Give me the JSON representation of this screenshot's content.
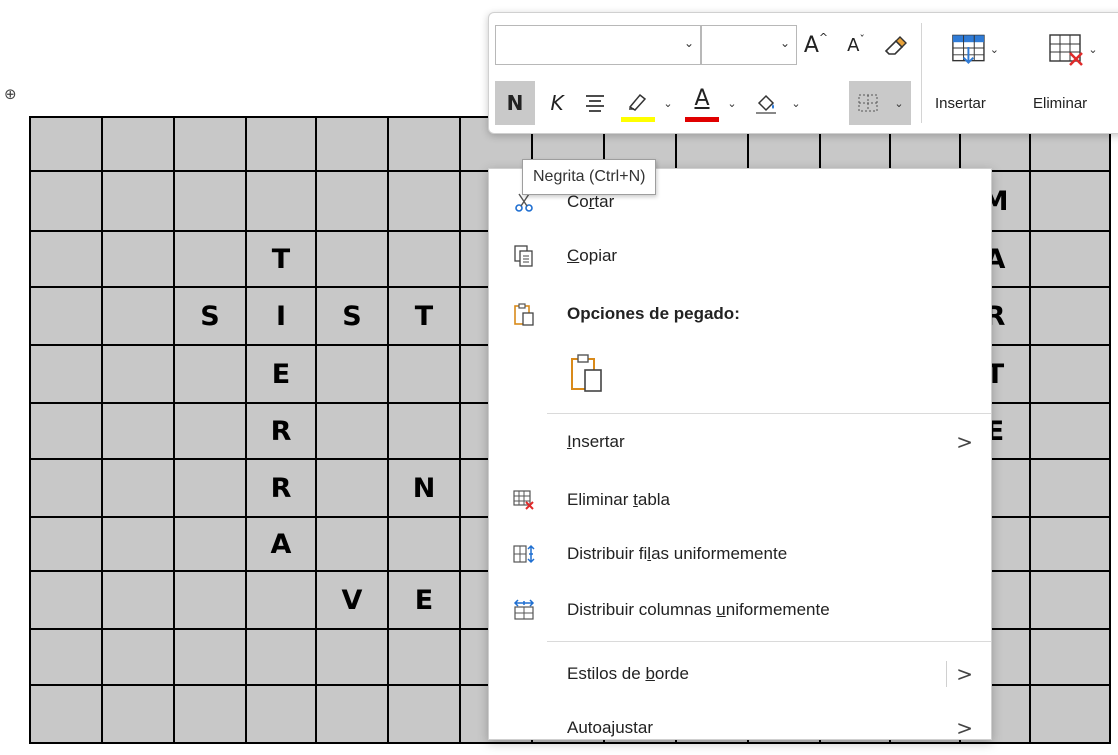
{
  "table": {
    "move_handle": "⊕",
    "rows": [
      [
        "",
        "",
        "",
        "",
        "",
        "",
        "",
        "",
        "",
        "",
        "",
        "",
        "",
        "",
        ""
      ],
      [
        "",
        "",
        "",
        "",
        "",
        "",
        "",
        "",
        "",
        "",
        "",
        "",
        "",
        "M",
        ""
      ],
      [
        "",
        "",
        "",
        "T",
        "",
        "",
        "",
        "",
        "",
        "",
        "",
        "",
        "",
        "A",
        ""
      ],
      [
        "",
        "",
        "S",
        "I",
        "S",
        "T",
        "",
        "",
        "",
        "",
        "",
        "",
        "",
        "R",
        ""
      ],
      [
        "",
        "",
        "",
        "E",
        "",
        "",
        "",
        "",
        "",
        "",
        "",
        "",
        "",
        "T",
        ""
      ],
      [
        "",
        "",
        "",
        "R",
        "",
        "",
        "",
        "",
        "",
        "",
        "",
        "",
        "",
        "E",
        ""
      ],
      [
        "",
        "",
        "",
        "R",
        "",
        "N",
        "",
        "",
        "",
        "",
        "",
        "",
        "",
        "",
        ""
      ],
      [
        "",
        "",
        "",
        "A",
        "",
        "",
        "",
        "",
        "",
        "",
        "",
        "",
        "",
        "",
        ""
      ],
      [
        "",
        "",
        "",
        "",
        "V",
        "E",
        "",
        "",
        "",
        "",
        "",
        "",
        "",
        "",
        ""
      ],
      [
        "",
        "",
        "",
        "",
        "",
        "",
        "",
        "",
        "",
        "",
        "",
        "",
        "",
        "",
        ""
      ],
      [
        "",
        "",
        "",
        "",
        "",
        "",
        "",
        "",
        "",
        "",
        "",
        "",
        "",
        "",
        ""
      ]
    ]
  },
  "mini_toolbar": {
    "font_name": "",
    "font_size": "",
    "grow_font": "A",
    "shrink_font": "A",
    "bold": "N",
    "italic": "K",
    "font_color_letter": "A",
    "highlight_color": "#ffff00",
    "font_color": "#e00000",
    "insert_label": "Insertar",
    "delete_label": "Eliminar"
  },
  "tooltip": "Negrita (Ctrl+N)",
  "context_menu": {
    "cut": {
      "pre": "Co",
      "u": "r",
      "post": "tar"
    },
    "copy": {
      "pre": "",
      "u": "C",
      "post": "opiar"
    },
    "paste_options": "Opciones de pegado:",
    "insert": {
      "pre": "",
      "u": "I",
      "post": "nsertar"
    },
    "delete_table": {
      "pre": "Eliminar ",
      "u": "t",
      "post": "abla"
    },
    "distribute_rows": {
      "pre": "Distribuir fi",
      "u": "l",
      "post": "as uniformemente"
    },
    "distribute_cols": {
      "pre": "Distribuir columnas ",
      "u": "u",
      "post": "niformemente"
    },
    "border_styles": {
      "pre": "Estilos de ",
      "u": "b",
      "post": "orde"
    },
    "autofit": "Autoajustar",
    "submenu_arrow": ">"
  }
}
